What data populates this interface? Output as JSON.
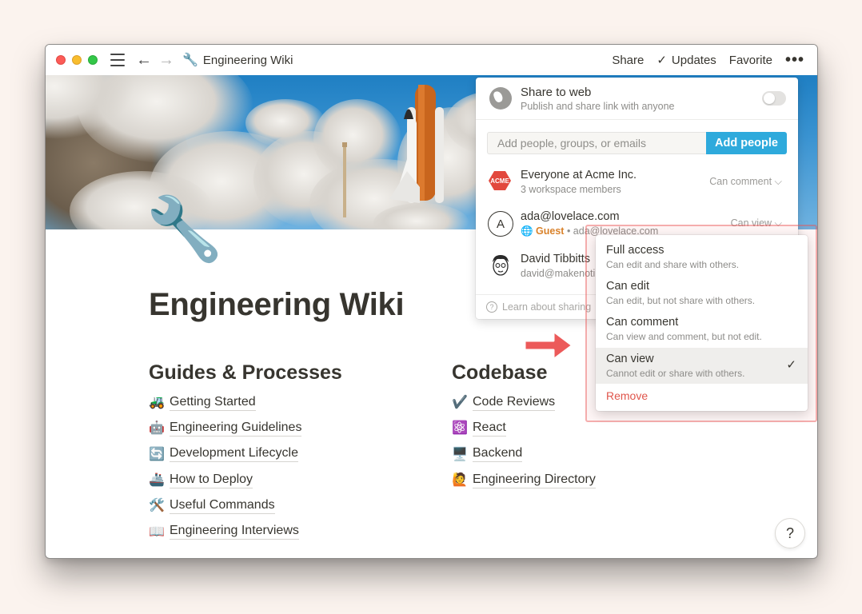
{
  "topbar": {
    "page_icon": "🔧",
    "page_title": "Engineering Wiki",
    "share_label": "Share",
    "updates_label": "Updates",
    "favorite_label": "Favorite",
    "more_label": "•••"
  },
  "page": {
    "icon": "🔧",
    "title": "Engineering Wiki",
    "help_label": "?"
  },
  "columns": [
    {
      "heading": "Guides & Processes",
      "links": [
        {
          "emoji": "🚜",
          "label": "Getting Started"
        },
        {
          "emoji": "🤖",
          "label": "Engineering Guidelines"
        },
        {
          "emoji": "🔄",
          "label": "Development Lifecycle"
        },
        {
          "emoji": "🚢",
          "label": "How to Deploy"
        },
        {
          "emoji": "🛠️",
          "label": "Useful Commands"
        },
        {
          "emoji": "📖",
          "label": "Engineering Interviews"
        }
      ]
    },
    {
      "heading": "Codebase",
      "links": [
        {
          "emoji": "✔️",
          "label": "Code Reviews"
        },
        {
          "emoji": "⚛️",
          "label": "React"
        },
        {
          "emoji": "🖥️",
          "label": "Backend"
        },
        {
          "emoji": "🙋",
          "label": "Engineering Directory"
        }
      ]
    }
  ],
  "share_popover": {
    "web_title": "Share to web",
    "web_subtitle": "Publish and share link with anyone",
    "invite_placeholder": "Add people, groups, or emails",
    "add_people_label": "Add people",
    "members": [
      {
        "name": "Everyone at Acme Inc.",
        "sub": "3 workspace members",
        "permission": "Can comment ⌵",
        "logo_text": "ACME"
      },
      {
        "name": "ada@lovelace.com",
        "guest_label": "🌐 Guest",
        "sub": " • ada@lovelace.com",
        "permission": "Can view ⌵",
        "avatar_letter": "A"
      },
      {
        "name": "David Tibbitts",
        "sub": "david@makenoti"
      }
    ],
    "learn_label": "Learn about sharing"
  },
  "permission_menu": {
    "options": [
      {
        "title": "Full access",
        "desc": "Can edit and share with others."
      },
      {
        "title": "Can edit",
        "desc": "Can edit, but not share with others."
      },
      {
        "title": "Can comment",
        "desc": "Can view and comment, but not edit."
      },
      {
        "title": "Can view",
        "desc": "Cannot edit or share with others.",
        "selected": true
      }
    ],
    "check": "✓",
    "remove_label": "Remove"
  },
  "colors": {
    "accent_blue": "#2eaadc",
    "remove_red": "#e0554b",
    "guest_orange": "#d9822b",
    "highlight_red": "#eb5757"
  }
}
